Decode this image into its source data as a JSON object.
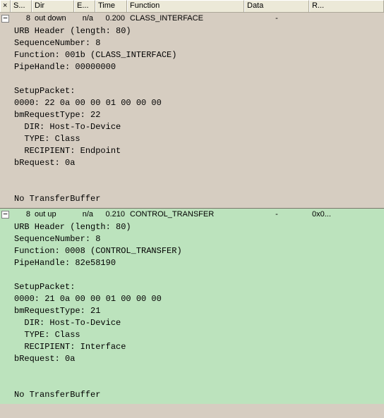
{
  "columns": {
    "star": "×",
    "seq": "S...",
    "dir": "Dir",
    "err": "E...",
    "time": "Time",
    "func": "Function",
    "data": "Data",
    "raw": "R..."
  },
  "rows": [
    {
      "seq": "8",
      "dir": "out down",
      "err": "n/a",
      "time": "0.200",
      "func": "CLASS_INTERFACE",
      "data": "-",
      "raw": "",
      "details": "URB Header (length: 80)\nSequenceNumber: 8\nFunction: 001b (CLASS_INTERFACE)\nPipeHandle: 00000000\n\nSetupPacket:\n0000: 22 0a 00 00 01 00 00 00\nbmRequestType: 22\n  DIR: Host-To-Device\n  TYPE: Class\n  RECIPIENT: Endpoint\nbRequest: 0a\n\n\nNo TransferBuffer\n"
    },
    {
      "seq": "8",
      "dir": "out up",
      "err": "n/a",
      "time": "0.210",
      "func": "CONTROL_TRANSFER",
      "data": "-",
      "raw": "0x0...",
      "details": "URB Header (length: 80)\nSequenceNumber: 8\nFunction: 0008 (CONTROL_TRANSFER)\nPipeHandle: 82e58190\n\nSetupPacket:\n0000: 21 0a 00 00 01 00 00 00\nbmRequestType: 21\n  DIR: Host-To-Device\n  TYPE: Class\n  RECIPIENT: Interface\nbRequest: 0a\n\n\nNo TransferBuffer\n"
    }
  ]
}
